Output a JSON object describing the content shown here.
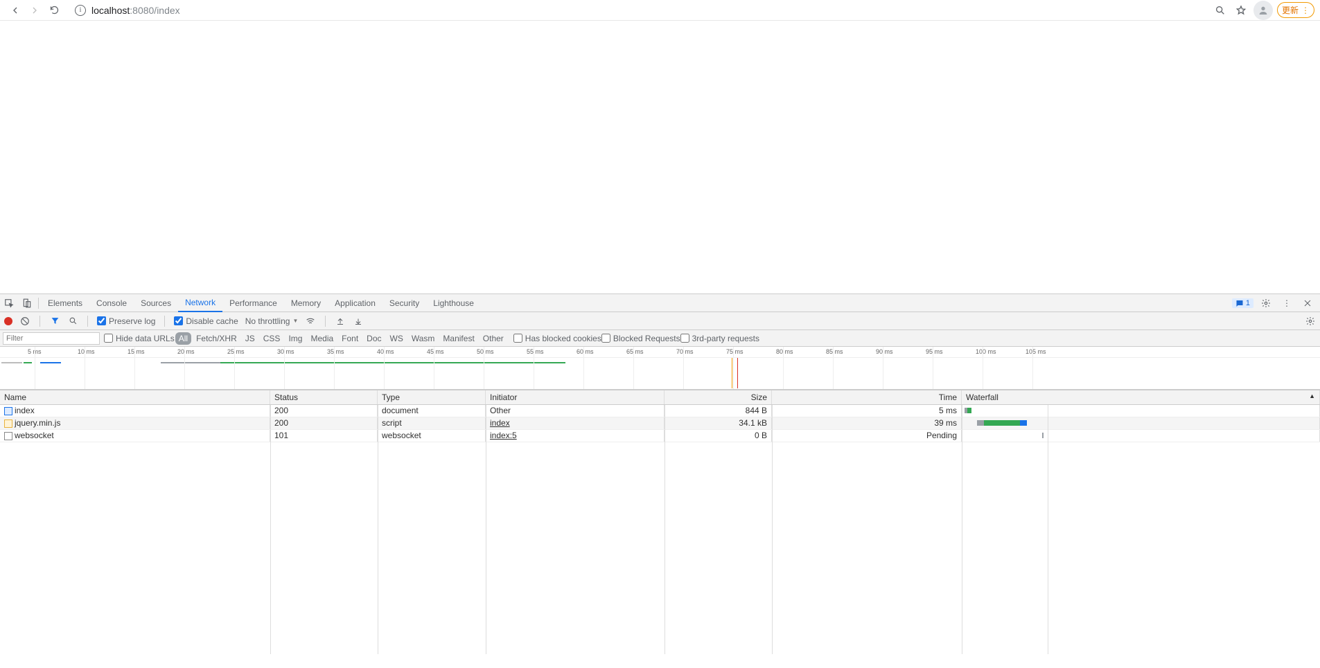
{
  "browser": {
    "url_host": "localhost",
    "url_rest": ":8080/index",
    "update_label": "更新"
  },
  "devtools": {
    "tabs": [
      "Elements",
      "Console",
      "Sources",
      "Network",
      "Performance",
      "Memory",
      "Application",
      "Security",
      "Lighthouse"
    ],
    "active_tab": "Network",
    "issues_count": "1",
    "toolbar2": {
      "preserve_log": "Preserve log",
      "disable_cache": "Disable cache",
      "throttling": "No throttling"
    },
    "filter": {
      "placeholder": "Filter",
      "hide_data_urls": "Hide data URLs",
      "types": [
        "All",
        "Fetch/XHR",
        "JS",
        "CSS",
        "Img",
        "Media",
        "Font",
        "Doc",
        "WS",
        "Wasm",
        "Manifest",
        "Other"
      ],
      "has_blocked_cookies": "Has blocked cookies",
      "blocked_requests": "Blocked Requests",
      "third_party": "3rd-party requests"
    },
    "timeline_ticks": [
      "5 ms",
      "10 ms",
      "15 ms",
      "20 ms",
      "25 ms",
      "30 ms",
      "35 ms",
      "40 ms",
      "45 ms",
      "50 ms",
      "55 ms",
      "60 ms",
      "65 ms",
      "70 ms",
      "75 ms",
      "80 ms",
      "85 ms",
      "90 ms",
      "95 ms",
      "100 ms",
      "105 ms"
    ],
    "net_columns": [
      "Name",
      "Status",
      "Type",
      "Initiator",
      "Size",
      "Time",
      "Waterfall"
    ],
    "rows": [
      {
        "icon": "doc",
        "name": "index",
        "status": "200",
        "type": "document",
        "initiator": "Other",
        "size": "844 B",
        "time": "5 ms"
      },
      {
        "icon": "js",
        "name": "jquery.min.js",
        "status": "200",
        "type": "script",
        "initiator": "index",
        "size": "34.1 kB",
        "time": "39 ms"
      },
      {
        "icon": "ws",
        "name": "websocket",
        "status": "101",
        "type": "websocket",
        "initiator": "index:5",
        "size": "0 B",
        "time": "Pending"
      }
    ]
  }
}
